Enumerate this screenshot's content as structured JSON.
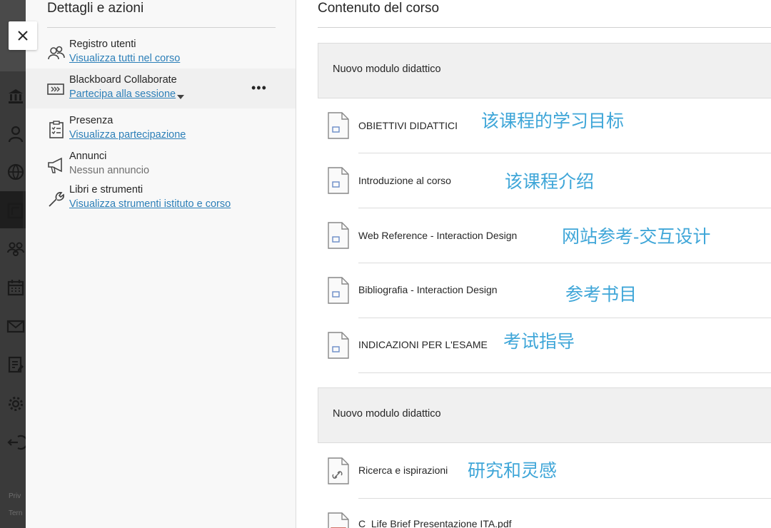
{
  "rail": {
    "footer_line1": "Priv",
    "footer_line2": "Tern"
  },
  "details": {
    "title": "Dettagli e azioni",
    "items": [
      {
        "icon": "users-icon",
        "title": "Registro utenti",
        "link": "Visualizza tutti nel corso"
      },
      {
        "icon": "collaborate-icon",
        "title": "Blackboard Collaborate",
        "link": "Partecipa alla sessione"
      },
      {
        "icon": "attendance-icon",
        "title": "Presenza",
        "link": "Visualizza partecipazione"
      },
      {
        "icon": "megaphone-icon",
        "title": "Annunci",
        "sub": "Nessun annuncio"
      },
      {
        "icon": "wrench-icon",
        "title": "Libri e strumenti",
        "link": "Visualizza strumenti istituto e corso"
      }
    ],
    "more_label": "•••"
  },
  "content": {
    "title": "Contenuto del corso",
    "modules": [
      {
        "label": "Nuovo modulo didattico"
      },
      {
        "label": "Nuovo modulo didattico"
      }
    ],
    "rows": [
      {
        "label": "OBIETTIVI DIDATTICI",
        "note": "该课程的学习目标",
        "icon": "document-icon"
      },
      {
        "label": "Introduzione al corso",
        "note": "该课程介绍",
        "icon": "document-icon"
      },
      {
        "label": "Web Reference - Interaction Design",
        "note": "网站参考-交互设计",
        "icon": "document-icon"
      },
      {
        "label": "Bibliografia - Interaction Design",
        "note": "参考书目",
        "icon": "document-icon"
      },
      {
        "label": "INDICAZIONI PER L'ESAME",
        "note": "考试指导",
        "icon": "document-icon"
      },
      {
        "label": "Ricerca e ispirazioni",
        "note": "研究和灵感",
        "icon": "link-document-icon"
      },
      {
        "label": "C_Life Brief Presentazione ITA.pdf",
        "note": "",
        "icon": "pdf-document-icon"
      }
    ]
  },
  "colors": {
    "link": "#2c7fb8",
    "annotation": "#3fa6d8",
    "rail": "#3a3a3a"
  }
}
